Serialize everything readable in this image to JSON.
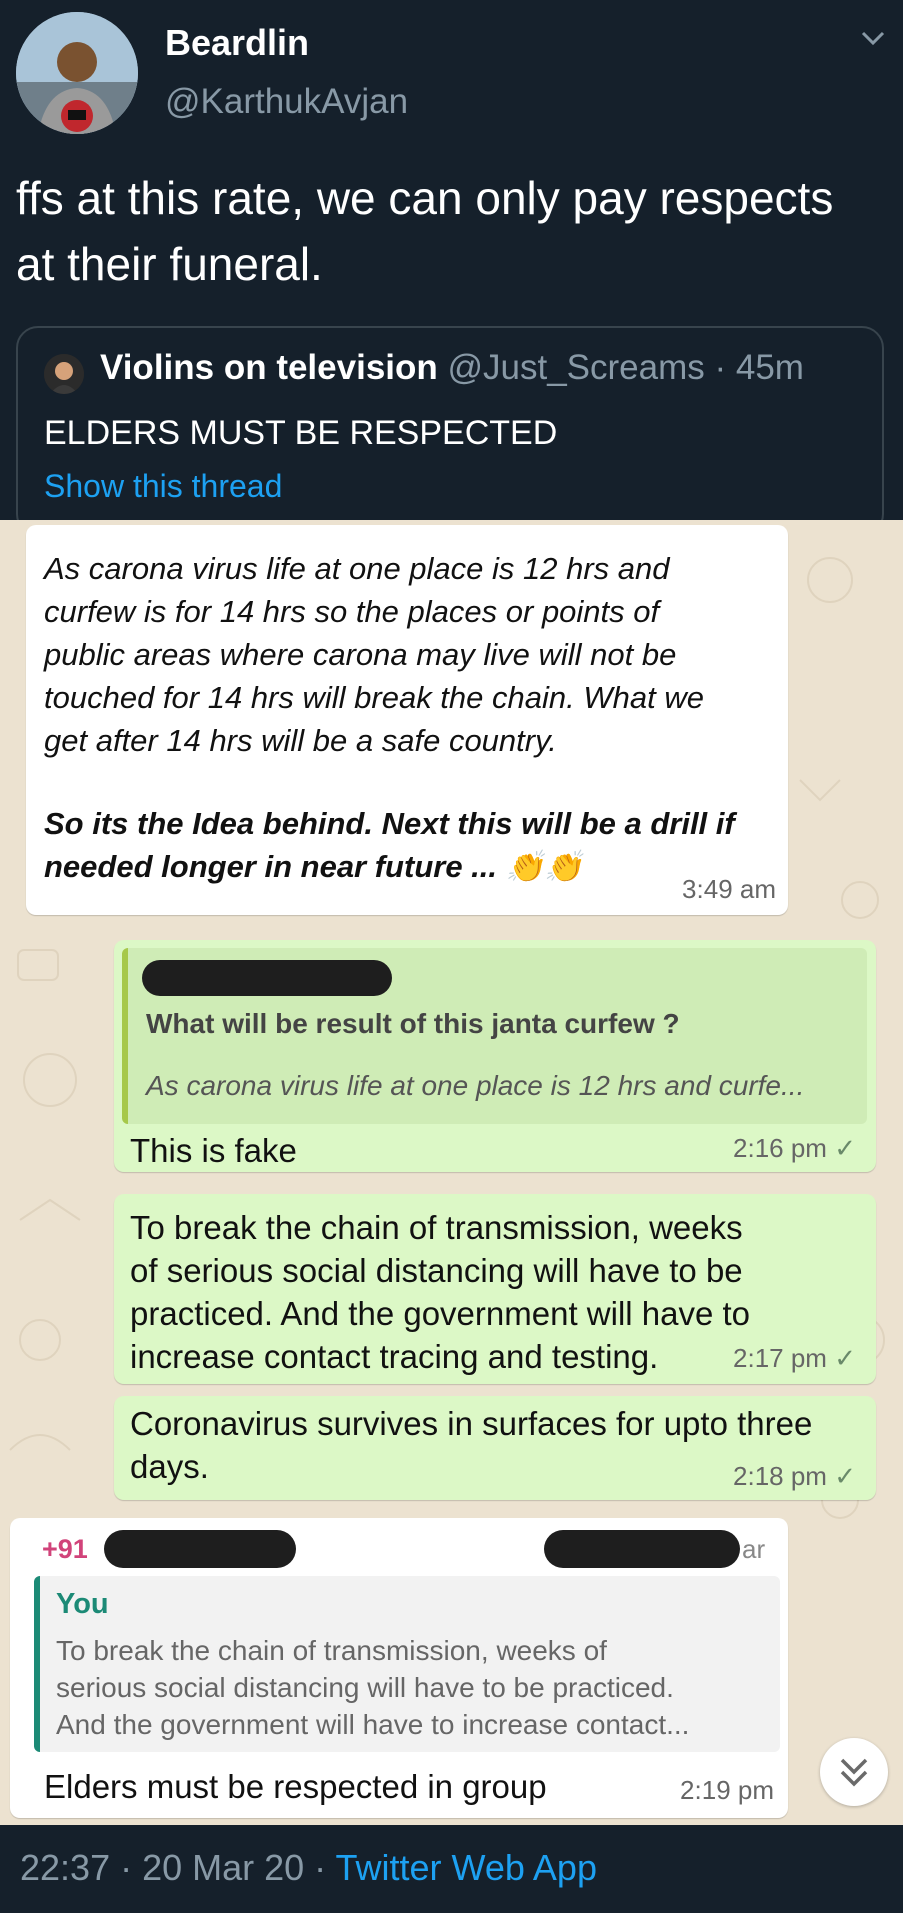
{
  "tweet": {
    "author_name": "Beardlin",
    "author_handle": "@KarthukAvjan",
    "text": "ffs at this rate, we can only pay respects at their funeral.",
    "quoted": {
      "name": "Violins on television",
      "handle_time": "@Just_Screams · 45m",
      "text": "ELDERS MUST BE RESPECTED",
      "show_thread": "Show this thread"
    },
    "footer": {
      "time_date": "22:37 · 20 Mar 20 · ",
      "app": "Twitter Web App"
    }
  },
  "chat": {
    "msg1": {
      "line1": "As carona virus life at one place is 12 hrs and",
      "line2": "curfew is for 14 hrs so the places  or points of",
      "line3": "public areas where  carona may live will not be",
      "line4": "touched for 14 hrs will break the chain. What we",
      "line5": "get  after 14 hrs will be a safe country.",
      "bold1": "So its the Idea behind. Next this will be a drill if",
      "bold2": "needed longer in near future ...",
      "emoji": "👏👏",
      "time": "3:49 am"
    },
    "msg2": {
      "reply_title": "What will be result of this janta curfew ?",
      "reply_snippet": "As carona virus life at one place is 12 hrs and curfe...",
      "text": "This is fake",
      "time": "2:16 pm"
    },
    "msg3": {
      "line1": "To break the chain of transmission, weeks",
      "line2": "of serious social distancing will have to be",
      "line3": "practiced. And the government will have to",
      "line4": "increase contact tracing and testing.",
      "time": "2:17 pm"
    },
    "msg4": {
      "line1": "Coronavirus survives in surfaces for upto three",
      "line2": "days.",
      "time": "2:18 pm"
    },
    "msg5": {
      "sender_prefix": "+91",
      "sender_suffix": "ar",
      "reply_author": "You",
      "reply_line1": "To break the chain of transmission, weeks of",
      "reply_line2": "serious social distancing will have to be practiced.",
      "reply_line3": "And the government will have to increase contact...",
      "text": "Elders must be respected in group",
      "time": "2:19 pm"
    },
    "tick": "✓"
  }
}
